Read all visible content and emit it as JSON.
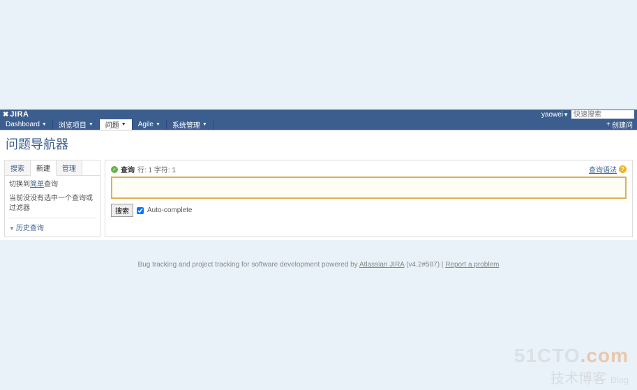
{
  "header": {
    "logo": "JIRA",
    "user": "yaowei",
    "search_placeholder": "快速搜索"
  },
  "nav": {
    "items": [
      {
        "label": "Dashboard"
      },
      {
        "label": "浏览项目"
      },
      {
        "label": "问题"
      },
      {
        "label": "Agile"
      },
      {
        "label": "系统管理"
      }
    ],
    "create": "创建问"
  },
  "page": {
    "title": "问题导航器"
  },
  "sidebar": {
    "tabs": [
      {
        "label": "搜索"
      },
      {
        "label": "新建"
      },
      {
        "label": "管理"
      }
    ],
    "switch_prefix": "切换到",
    "switch_link": "简单",
    "switch_suffix": "查询",
    "status_text": "当前没没有选中一个查询或过滤器",
    "history_label": "历史查询"
  },
  "query": {
    "label": "查询",
    "info": "行: 1 字符: 1",
    "syntax_link": "查询语法",
    "search_button": "搜索",
    "autocomplete_label": "Auto-complete"
  },
  "footer": {
    "text_prefix": "Bug tracking and project tracking for software development powered by ",
    "jira_link": "Atlassian JIRA",
    "version": " (v4.2#587) | ",
    "report_link": "Report a problem"
  },
  "watermark": {
    "line1a": "51CTO",
    "line1b": ".com",
    "line2": "技术博客",
    "blog": "Blog"
  }
}
